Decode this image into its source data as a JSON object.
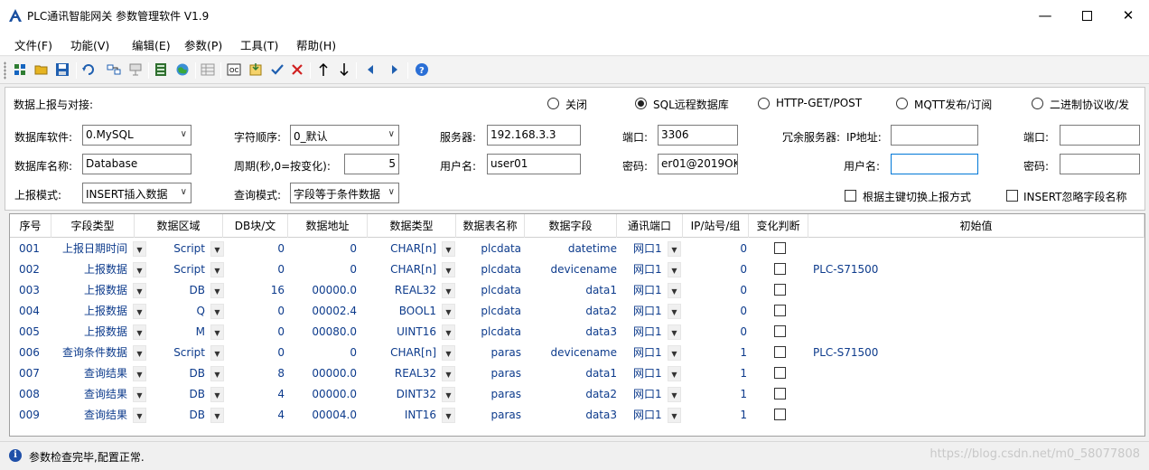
{
  "window": {
    "title": "PLC通讯智能网关 参数管理软件 V1.9",
    "min": "—",
    "max": "☐",
    "close": "✕"
  },
  "menu": [
    "文件(F)",
    "功能(V)",
    "编辑(E)",
    "参数(P)",
    "工具(T)",
    "帮助(H)"
  ],
  "report": {
    "label": "数据上报与对接:",
    "options": [
      "关闭",
      "SQL远程数据库",
      "HTTP-GET/POST",
      "MQTT发布/订阅",
      "二进制协议收/发"
    ],
    "selected": 1
  },
  "form": {
    "db_software_label": "数据库软件:",
    "db_software": "0.MySQL",
    "byte_order_label": "字符顺序:",
    "byte_order": "0_默认",
    "server_label": "服务器:",
    "server": "192.168.3.3",
    "port_label": "端口:",
    "port": "3306",
    "redundant_label": "冗余服务器:",
    "ip_label": "IP地址:",
    "redundant_ip": "",
    "redundant_port_label": "端口:",
    "redundant_port": "",
    "db_name_label": "数据库名称:",
    "db_name": "Database",
    "period_label": "周期(秒,0=按变化):",
    "period": "5",
    "user_label": "用户名:",
    "user": "user01",
    "pwd_label": "密码:",
    "pwd": "er01@2019OK",
    "redundant_user_label": "用户名:",
    "redundant_user": "",
    "redundant_pwd_label": "密码:",
    "redundant_pwd": "",
    "report_mode_label": "上报模式:",
    "report_mode": "INSERT插入数据",
    "query_mode_label": "查询模式:",
    "query_mode": "字段等于条件数据",
    "switch_by_key_label": "根据主键切换上报方式",
    "insert_ignore_label": "INSERT忽略字段名称"
  },
  "table": {
    "headers": [
      "序号",
      "字段类型",
      "数据区域",
      "DB块/文",
      "数据地址",
      "数据类型",
      "数据表名称",
      "数据字段",
      "通讯端口",
      "IP/站号/组",
      "变化判断",
      "初始值"
    ],
    "rows": [
      [
        "001",
        "上报日期时间",
        "Script",
        "0",
        "0",
        "CHAR[n]",
        "plcdata",
        "datetime",
        "网口1",
        "0",
        ""
      ],
      [
        "002",
        "上报数据",
        "Script",
        "0",
        "0",
        "CHAR[n]",
        "plcdata",
        "devicename",
        "网口1",
        "0",
        "PLC-S71500"
      ],
      [
        "003",
        "上报数据",
        "DB",
        "16",
        "00000.0",
        "REAL32",
        "plcdata",
        "data1",
        "网口1",
        "0",
        ""
      ],
      [
        "004",
        "上报数据",
        "Q",
        "0",
        "00002.4",
        "BOOL1",
        "plcdata",
        "data2",
        "网口1",
        "0",
        ""
      ],
      [
        "005",
        "上报数据",
        "M",
        "0",
        "00080.0",
        "UINT16",
        "plcdata",
        "data3",
        "网口1",
        "0",
        ""
      ],
      [
        "006",
        "查询条件数据",
        "Script",
        "0",
        "0",
        "CHAR[n]",
        "paras",
        "devicename",
        "网口1",
        "1",
        "PLC-S71500"
      ],
      [
        "007",
        "查询结果",
        "DB",
        "8",
        "00000.0",
        "REAL32",
        "paras",
        "data1",
        "网口1",
        "1",
        ""
      ],
      [
        "008",
        "查询结果",
        "DB",
        "4",
        "00000.0",
        "DINT32",
        "paras",
        "data2",
        "网口1",
        "1",
        ""
      ],
      [
        "009",
        "查询结果",
        "DB",
        "4",
        "00004.0",
        "INT16",
        "paras",
        "data3",
        "网口1",
        "1",
        ""
      ]
    ]
  },
  "status": {
    "message": "参数检查完毕,配置正常.",
    "watermark": "https://blog.csdn.net/m0_58077808"
  },
  "colors": {
    "accent": "#0078d7",
    "cell_text": "#0d3b8c"
  }
}
